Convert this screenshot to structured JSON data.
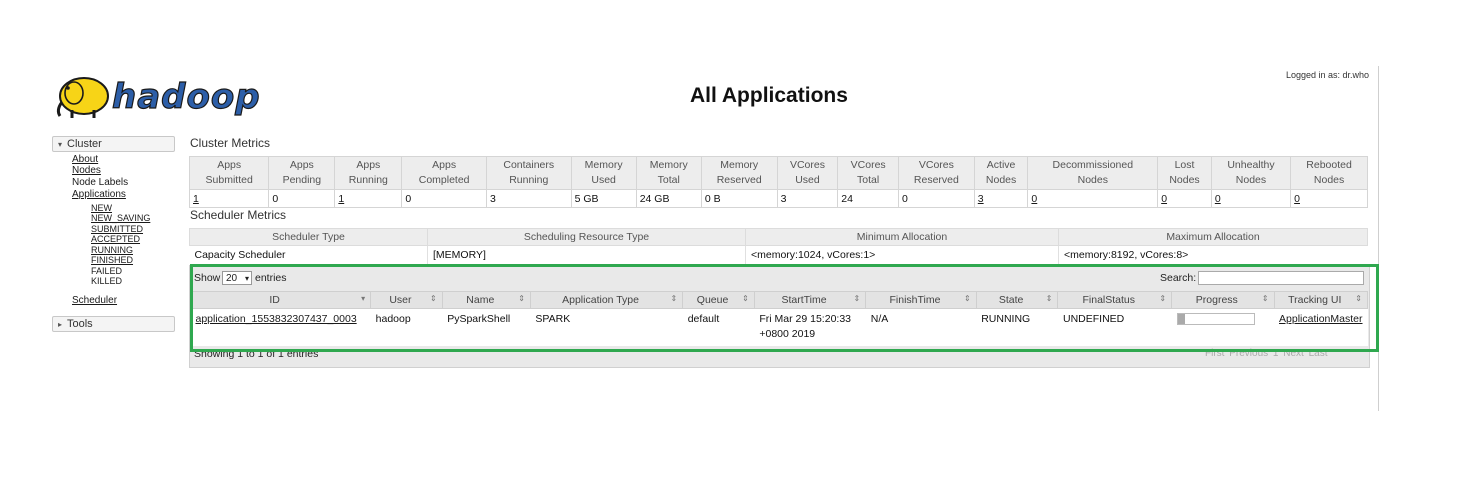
{
  "header": {
    "logo_text": "hadoop",
    "title": "All Applications",
    "logged_in": "Logged in as: dr.who"
  },
  "sidebar": {
    "cluster": {
      "label": "Cluster",
      "links": [
        "About",
        "Nodes",
        "Node Labels",
        "Applications"
      ],
      "app_states": [
        "NEW",
        "NEW_SAVING",
        "SUBMITTED",
        "ACCEPTED",
        "RUNNING",
        "FINISHED",
        "FAILED",
        "KILLED"
      ],
      "scheduler": "Scheduler"
    },
    "tools": {
      "label": "Tools"
    }
  },
  "cluster_metrics": {
    "title": "Cluster Metrics",
    "headers": [
      [
        "Apps",
        "Submitted"
      ],
      [
        "Apps",
        "Pending"
      ],
      [
        "Apps",
        "Running"
      ],
      [
        "Apps",
        "Completed"
      ],
      [
        "Containers",
        "Running"
      ],
      [
        "Memory",
        "Used"
      ],
      [
        "Memory",
        "Total"
      ],
      [
        "Memory",
        "Reserved"
      ],
      [
        "VCores",
        "Used"
      ],
      [
        "VCores",
        "Total"
      ],
      [
        "VCores",
        "Reserved"
      ],
      [
        "Active",
        "Nodes"
      ],
      [
        "Decommissioned",
        "Nodes"
      ],
      [
        "Lost",
        "Nodes"
      ],
      [
        "Unhealthy",
        "Nodes"
      ],
      [
        "Rebooted",
        "Nodes"
      ]
    ],
    "values": [
      "1",
      "0",
      "1",
      "0",
      "3",
      "5 GB",
      "24 GB",
      "0 B",
      "3",
      "24",
      "0",
      "3",
      "0",
      "0",
      "0",
      "0"
    ]
  },
  "scheduler_metrics": {
    "title": "Scheduler Metrics",
    "headers": [
      "Scheduler Type",
      "Scheduling Resource Type",
      "Minimum Allocation",
      "Maximum Allocation"
    ],
    "values": [
      "Capacity Scheduler",
      "[MEMORY]",
      "<memory:1024, vCores:1>",
      "<memory:8192, vCores:8>"
    ]
  },
  "applications": {
    "show_label": "Show",
    "page_size": "20",
    "entries_label": "entries",
    "search_label": "Search:",
    "search_value": "",
    "columns": [
      "ID",
      "User",
      "Name",
      "Application Type",
      "Queue",
      "StartTime",
      "FinishTime",
      "State",
      "FinalStatus",
      "Progress",
      "Tracking UI"
    ],
    "rows": [
      {
        "id": "application_1553832307437_0003",
        "user": "hadoop",
        "name": "PySparkShell",
        "type": "SPARK",
        "queue": "default",
        "start_time": "Fri Mar 29 15:20:33 +0800 2019",
        "finish_time": "N/A",
        "state": "RUNNING",
        "final_status": "UNDEFINED",
        "progress": 0.1,
        "tracking_ui": "ApplicationMaster"
      }
    ],
    "info": "Showing 1 to 1 of 1 entries",
    "pagination": [
      "First",
      "Previous",
      "1",
      "Next",
      "Last"
    ]
  },
  "colors": {
    "highlight": "#2fa84f",
    "header_bg": "#ededed",
    "logo_yellow": "#f7d417",
    "logo_blue": "#2c5ea8"
  }
}
